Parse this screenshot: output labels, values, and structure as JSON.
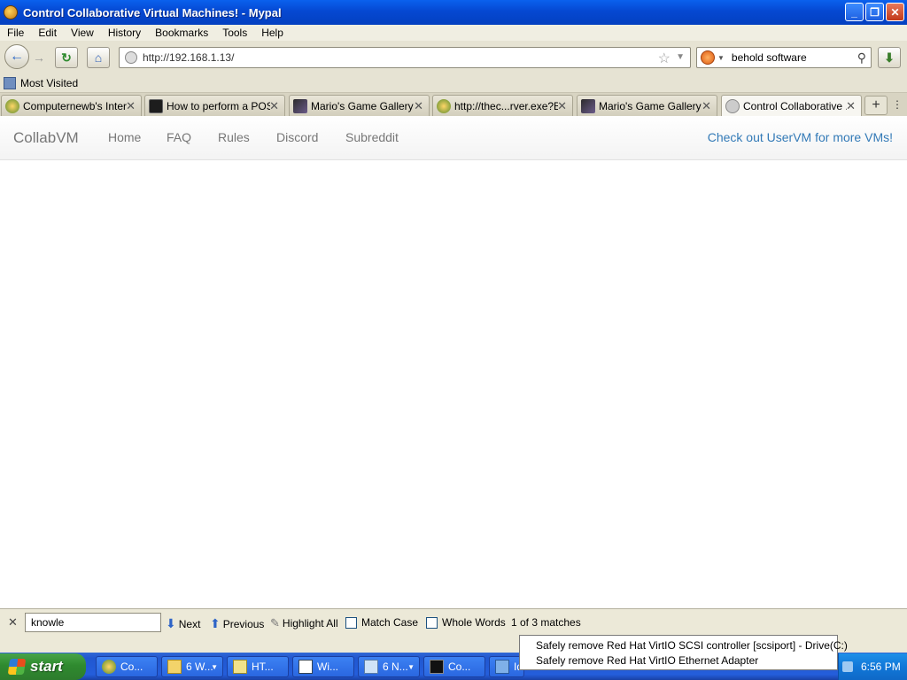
{
  "window": {
    "title": "Control Collaborative Virtual Machines! - Mypal",
    "minimize": "_",
    "maximize": "❐",
    "close": "✕"
  },
  "menu": [
    "File",
    "Edit",
    "View",
    "History",
    "Bookmarks",
    "Tools",
    "Help"
  ],
  "nav": {
    "url": "http://192.168.1.13/",
    "search": "behold software"
  },
  "bookmarks": {
    "most_visited": "Most Visited"
  },
  "tabs": [
    {
      "label": "Computernewb's Inter...",
      "icon": "raccoon-icon"
    },
    {
      "label": "How to perform a POS...",
      "icon": "terminal-icon"
    },
    {
      "label": "Mario's Game Gallery | ...",
      "icon": "mario-icon"
    },
    {
      "label": "http://thec...rver.exe?B",
      "icon": "raccoon-icon"
    },
    {
      "label": "Mario's Game Gallery | ...",
      "icon": "mario-icon"
    },
    {
      "label": "Control Collaborative ...",
      "icon": "globe-icon",
      "active": true
    }
  ],
  "page": {
    "brand": "CollabVM",
    "links": [
      "Home",
      "FAQ",
      "Rules",
      "Discord",
      "Subreddit"
    ],
    "promo": "Check out UserVM for more VMs!"
  },
  "find": {
    "query": "knowle",
    "next": "Next",
    "previous": "Previous",
    "highlight_all": "Highlight All",
    "match_case": "Match Case",
    "whole_words": "Whole Words",
    "status": "1 of 3 matches"
  },
  "balloon": {
    "line1": "Safely remove Red Hat VirtIO SCSI controller [scsiport] - Drive(C:)",
    "line2": "Safely remove Red Hat VirtIO Ethernet Adapter"
  },
  "taskbar": {
    "start": "start",
    "tasks": [
      "Co...",
      "6 W...",
      "HT...",
      "Wi...",
      "6 N...",
      "Co...",
      "Id"
    ],
    "clock": "6:56 PM"
  },
  "colors": {
    "accent_link": "#337ab7",
    "titlebar": "#0548d2",
    "start_button": "#2f8a2f"
  }
}
